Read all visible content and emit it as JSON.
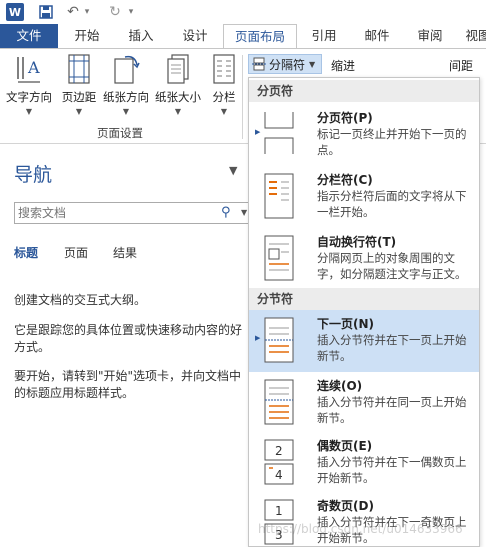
{
  "quick_access": {
    "app_icon": "W",
    "undo_glyph": "↶",
    "undo_menu": "▾",
    "redo_glyph": "↻",
    "redo_menu": "▾"
  },
  "tabs": [
    "文件",
    "开始",
    "插入",
    "设计",
    "页面布局",
    "引用",
    "邮件",
    "审阅",
    "视图"
  ],
  "ribbon": {
    "buttons": [
      "文字方向",
      "页边距",
      "纸张方向",
      "纸张大小",
      "分栏"
    ],
    "group_label": "页面设置",
    "breaks_label": "分隔符",
    "indent_label": "缩进",
    "spacing_label": "间距"
  },
  "nav": {
    "title": "导航",
    "search_placeholder": "搜索文档",
    "tabs": [
      "标题",
      "页面",
      "结果"
    ],
    "text1": "创建文档的交互式大纲。",
    "text2": "它是跟踪您的具体位置或快速移动内容的好方式。",
    "text3": "要开始，请转到\"开始\"选项卡，并向文档中的标题应用标题样式。"
  },
  "breaks_menu": {
    "section_page": "分页符",
    "section_section": "分节符",
    "items": [
      {
        "title": "分页符(P)",
        "desc": "标记一页终止并开始下一页的点。"
      },
      {
        "title": "分栏符(C)",
        "desc": "指示分栏符后面的文字将从下一栏开始。"
      },
      {
        "title": "自动换行符(T)",
        "desc": "分隔网页上的对象周围的文字，如分隔题注文字与正文。"
      },
      {
        "title": "下一页(N)",
        "desc": "插入分节符并在下一页上开始新节。"
      },
      {
        "title": "连续(O)",
        "desc": "插入分节符并在同一页上开始新节。"
      },
      {
        "title": "偶数页(E)",
        "desc": "插入分节符并在下一偶数页上开始新节。"
      },
      {
        "title": "奇数页(D)",
        "desc": "插入分节符并在下一奇数页上开始新节。"
      }
    ]
  },
  "watermark": "https://blog.csdn.net/u014633966"
}
